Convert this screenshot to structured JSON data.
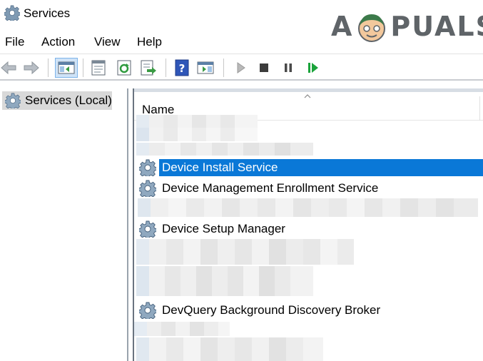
{
  "window": {
    "title": "Services"
  },
  "watermark": {
    "left": "A",
    "right": "PUALS"
  },
  "menu": [
    "File",
    "Action",
    "View",
    "Help"
  ],
  "toolbar": {
    "buttons": [
      "back-arrow-icon",
      "forward-arrow-icon",
      "show-hide-console-tree-icon",
      "properties-icon",
      "refresh-icon",
      "export-list-icon",
      "help-icon",
      "show-action-pane-icon",
      "start-service-icon",
      "stop-service-icon",
      "pause-service-icon",
      "resume-service-icon"
    ]
  },
  "tree": {
    "root_label": "Services (Local)"
  },
  "list": {
    "column_name": "Name",
    "services": [
      {
        "name": "Device Install Service",
        "selected": true
      },
      {
        "name": "Device Management Enrollment Service",
        "selected": false
      },
      {
        "name": "Device Setup Manager",
        "selected": false
      },
      {
        "name": "DevQuery Background Discovery Broker",
        "selected": false
      }
    ]
  },
  "colors": {
    "selection": "#0a78d7",
    "tree_selected": "#d9d9d9",
    "play_green": "#1aa33a"
  }
}
